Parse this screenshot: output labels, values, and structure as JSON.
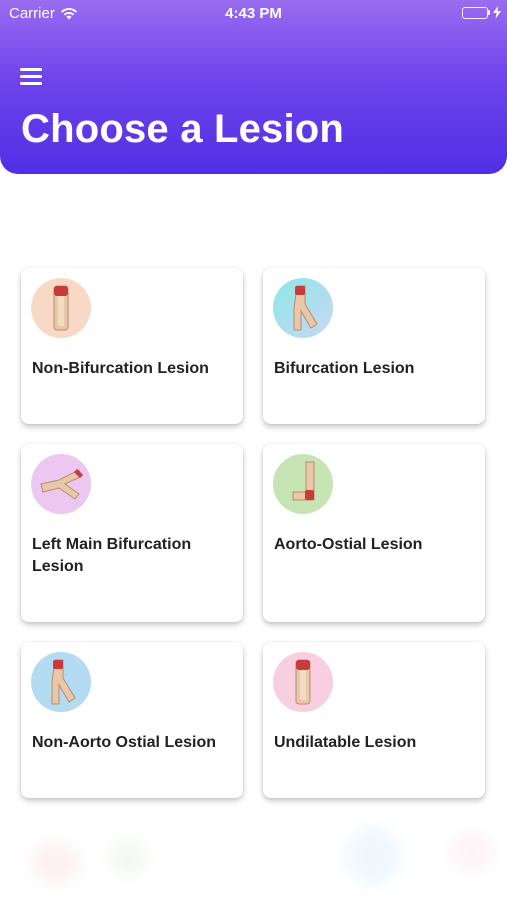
{
  "status_bar": {
    "carrier": "Carrier",
    "time": "4:43 PM"
  },
  "header": {
    "title": "Choose a Lesion",
    "gradient_top": "#9a6cf0",
    "gradient_bottom": "#4f2fe4"
  },
  "lesions": [
    {
      "label": "Non-Bifurcation Lesion",
      "icon": "straight-vessel-icon",
      "icon_bg": "#f8d9c8"
    },
    {
      "label": "Bifurcation Lesion",
      "icon": "bifurcation-vessel-icon",
      "icon_bg": "#aee3f2"
    },
    {
      "label": "Left Main Bifurcation Lesion",
      "icon": "left-main-vessel-icon",
      "icon_bg": "#ecc8f0"
    },
    {
      "label": "Aorto-Ostial Lesion",
      "icon": "aorto-ostial-vessel-icon",
      "icon_bg": "#c7e4b5"
    },
    {
      "label": "Non-Aorto Ostial Lesion",
      "icon": "non-aorto-ostial-vessel-icon",
      "icon_bg": "#b3dbf2"
    },
    {
      "label": "Undilatable Lesion",
      "icon": "undilatable-vessel-icon",
      "icon_bg": "#f8cfe0"
    }
  ]
}
